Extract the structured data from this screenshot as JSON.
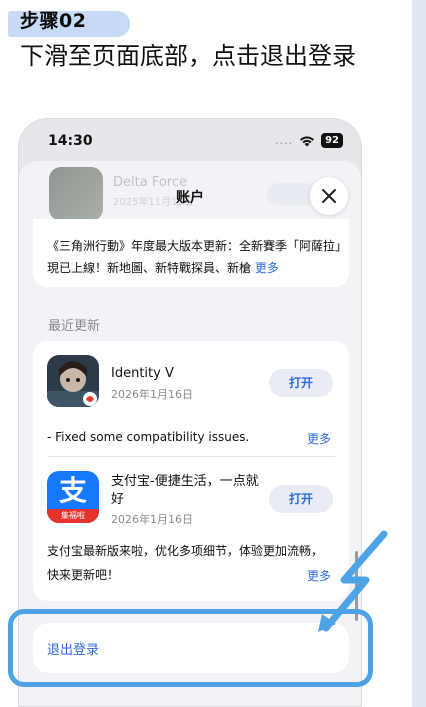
{
  "step": {
    "label": "步骤02"
  },
  "instruction": {
    "text": "下滑至页面底部，点击退出登录"
  },
  "status_bar": {
    "time": "14:30",
    "dots": "....",
    "battery": "92"
  },
  "sheet": {
    "title": "账户",
    "behind_app": {
      "name": "Delta Force",
      "date": "2025年11月15日"
    },
    "note": {
      "text": "《三角洲行動》年度最大版本更新：全新賽季「阿薩拉」現已上線！新地圖、新特戰探員、新槍",
      "more_label": "更多"
    },
    "section_label": "最近更新",
    "apps": [
      {
        "name": "Identity V",
        "date": "2026年1月16日",
        "button": "打开",
        "notes": "- Fixed some compatibility issues.",
        "more_label": "更多"
      },
      {
        "name": "支付宝-便捷生活，一点就好",
        "date": "2026年1月16日",
        "button": "打开",
        "icon_glyph": "支",
        "icon_tag": "集福啦",
        "notes": "支付宝最新版来啦，优化多项细节，体验更加流畅，快来更新吧！",
        "more_label": "更多"
      }
    ],
    "logout_label": "退出登录"
  },
  "colors": {
    "accent_blue": "#2f6bd8",
    "highlight": "#4ea3e6",
    "badge_bg": "#c7dbf6",
    "alipay_blue": "#1677ff"
  },
  "icons": [
    "wifi-icon",
    "battery-icon",
    "close-icon",
    "identity-v-app-icon",
    "alipay-app-icon",
    "annotation-arrow"
  ]
}
